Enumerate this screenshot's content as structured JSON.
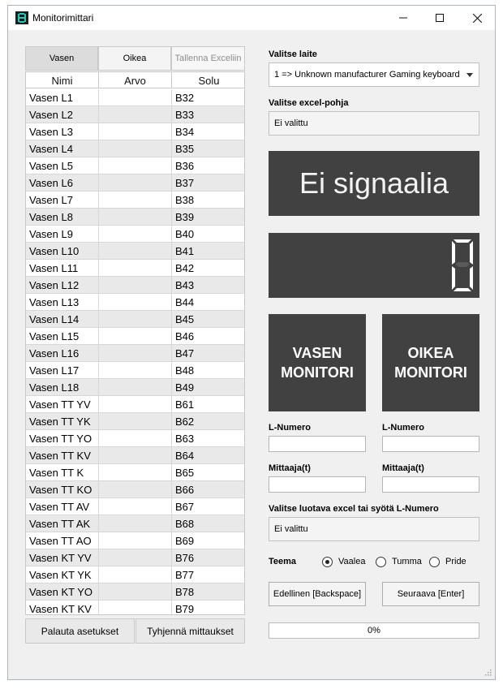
{
  "window": {
    "title": "Monitorimittari"
  },
  "tabs": [
    {
      "label": "Vasen",
      "active": true
    },
    {
      "label": "Oikea",
      "active": false
    },
    {
      "label": "Tallenna Exceliin",
      "disabled": true
    }
  ],
  "table": {
    "columns": [
      "Nimi",
      "Arvo",
      "Solu"
    ],
    "rows": [
      [
        "Vasen L1",
        "",
        "B32"
      ],
      [
        "Vasen L2",
        "",
        "B33"
      ],
      [
        "Vasen L3",
        "",
        "B34"
      ],
      [
        "Vasen L4",
        "",
        "B35"
      ],
      [
        "Vasen L5",
        "",
        "B36"
      ],
      [
        "Vasen L6",
        "",
        "B37"
      ],
      [
        "Vasen L7",
        "",
        "B38"
      ],
      [
        "Vasen L8",
        "",
        "B39"
      ],
      [
        "Vasen L9",
        "",
        "B40"
      ],
      [
        "Vasen L10",
        "",
        "B41"
      ],
      [
        "Vasen L11",
        "",
        "B42"
      ],
      [
        "Vasen L12",
        "",
        "B43"
      ],
      [
        "Vasen L13",
        "",
        "B44"
      ],
      [
        "Vasen L14",
        "",
        "B45"
      ],
      [
        "Vasen L15",
        "",
        "B46"
      ],
      [
        "Vasen L16",
        "",
        "B47"
      ],
      [
        "Vasen L17",
        "",
        "B48"
      ],
      [
        "Vasen L18",
        "",
        "B49"
      ],
      [
        "Vasen TT YV",
        "",
        "B61"
      ],
      [
        "Vasen TT YK",
        "",
        "B62"
      ],
      [
        "Vasen TT YO",
        "",
        "B63"
      ],
      [
        "Vasen TT KV",
        "",
        "B64"
      ],
      [
        "Vasen TT K",
        "",
        "B65"
      ],
      [
        "Vasen TT KO",
        "",
        "B66"
      ],
      [
        "Vasen TT AV",
        "",
        "B67"
      ],
      [
        "Vasen TT AK",
        "",
        "B68"
      ],
      [
        "Vasen TT AO",
        "",
        "B69"
      ],
      [
        "Vasen KT YV",
        "",
        "B76"
      ],
      [
        "Vasen KT YK",
        "",
        "B77"
      ],
      [
        "Vasen KT YO",
        "",
        "B78"
      ],
      [
        "Vasen KT KV",
        "",
        "B79"
      ]
    ]
  },
  "bottom_buttons": {
    "reset": "Palauta asetukset",
    "clear": "Tyhjennä mittaukset"
  },
  "device": {
    "label": "Valitse laite",
    "selected": "1 => Unknown manufacturer Gaming keyboard"
  },
  "template": {
    "label": "Valitse excel-pohja",
    "value": "Ei valittu"
  },
  "signal": {
    "text": "Ei signaalia"
  },
  "digit_display": {
    "value": "0"
  },
  "monitors": {
    "left": {
      "line1": "VASEN",
      "line2": "MONITORI"
    },
    "right": {
      "line1": "OIKEA",
      "line2": "MONITORI"
    }
  },
  "left_fields": {
    "lnumber_label": "L-Numero",
    "measurer_label": "Mittaaja(t)"
  },
  "right_fields": {
    "lnumber_label": "L-Numero",
    "measurer_label": "Mittaaja(t)"
  },
  "output": {
    "label": "Valitse luotava excel tai syötä L-Numero",
    "value": "Ei valittu"
  },
  "theme": {
    "label": "Teema",
    "options": [
      {
        "label": "Vaalea",
        "checked": true
      },
      {
        "label": "Tumma",
        "checked": false
      },
      {
        "label": "Pride",
        "checked": false
      }
    ]
  },
  "nav": {
    "prev": "Edellinen [Backspace]",
    "next": "Seuraava [Enter]"
  },
  "progress": {
    "text": "0%",
    "value": 0
  },
  "colors": {
    "display_bg": "#414141",
    "icon_accent": "#28c7b7"
  }
}
